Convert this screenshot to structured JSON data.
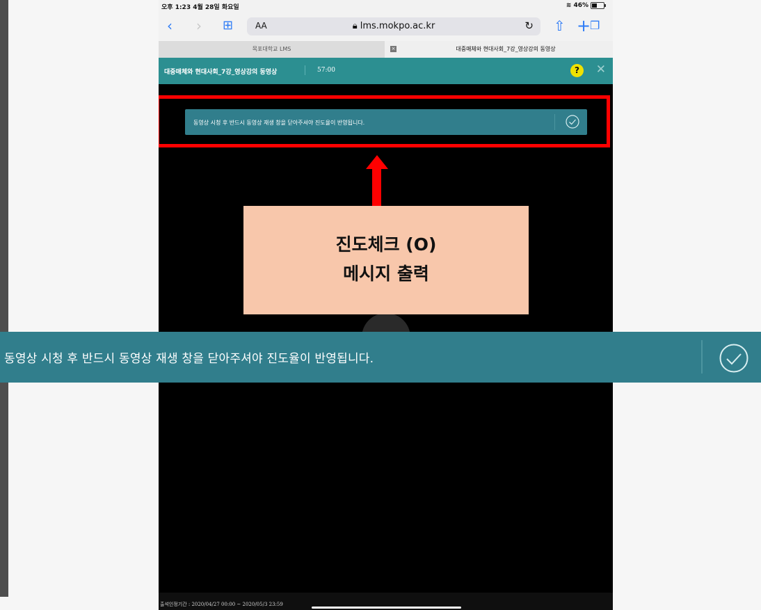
{
  "status_bar": {
    "time": "오후 1:23  4월 28일 화요일",
    "battery": "46%",
    "battery_fraction": 0.46
  },
  "toolbar": {
    "text_size_label": "AA",
    "url": "lms.mokpo.ac.kr"
  },
  "tabs": [
    {
      "label": "목포대학교 LMS"
    },
    {
      "label": "대중매체와 현대사회_7강_영상강의 동영상"
    }
  ],
  "player": {
    "title": "대중매체와 현대사회_7강_영상강의 동영상",
    "duration": "57:00",
    "help_label": "?"
  },
  "message": {
    "text": "동영상 시청 후 반드시 동영상 재생 창을 닫아주셔야 진도율이 반영됩니다."
  },
  "annotation": {
    "line1": "진도체크 (O)",
    "line2": "메시지 출력"
  },
  "footer": {
    "attendance_period": "출석인정기간 : 2020/04/27 00:00 ~ 2020/05/3 23:59"
  },
  "colors": {
    "teal_header": "#2c8f91",
    "message_bg": "#317e8c",
    "highlight_red": "#ff0000",
    "annotation_bg": "#f8c7ab"
  },
  "icons": [
    "back-icon",
    "forward-icon",
    "bookmarks-icon",
    "lock-icon",
    "reload-icon",
    "share-icon",
    "new-tab-icon",
    "tabs-icon",
    "wifi-icon",
    "battery-icon",
    "help-icon",
    "close-icon",
    "check-circle-icon",
    "play-icon"
  ]
}
